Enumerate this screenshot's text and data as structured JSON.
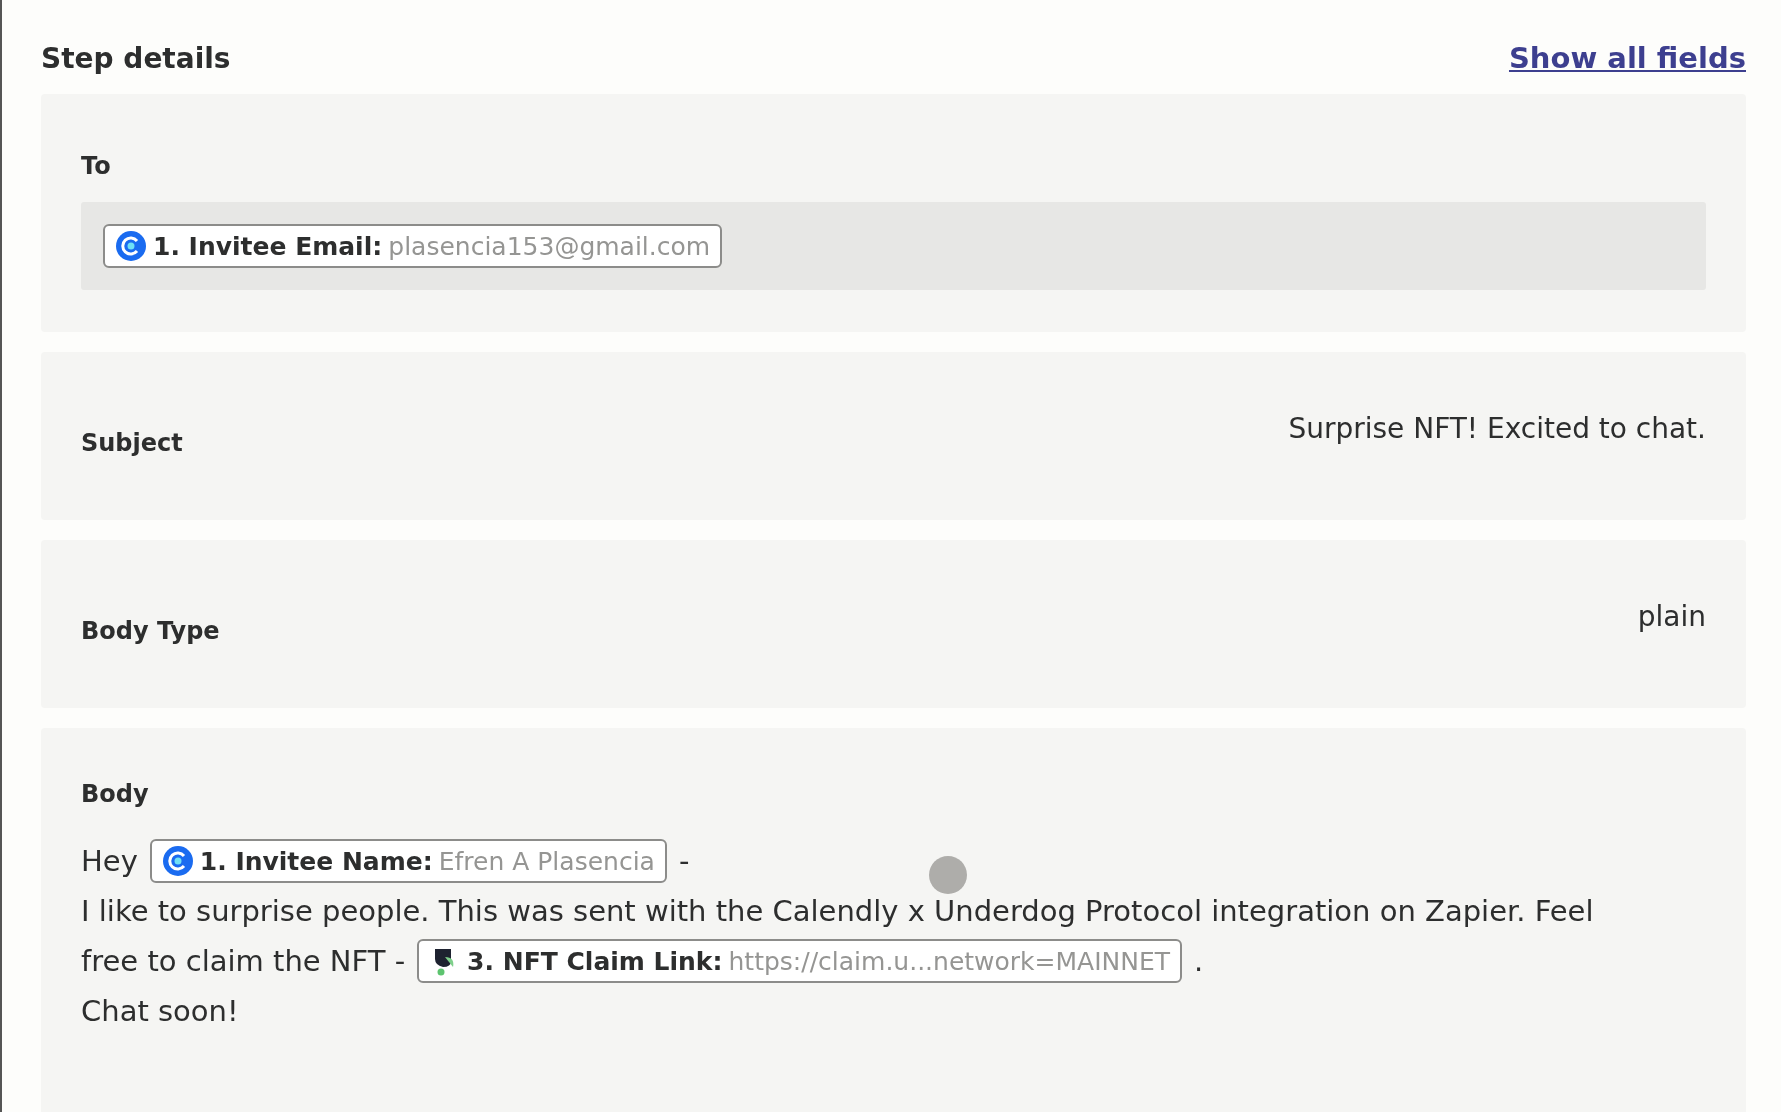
{
  "header": {
    "title": "Step details",
    "link": "Show all fields"
  },
  "fields": [
    {
      "kind": "pills",
      "label": "To",
      "pills": [
        {
          "kind": "calendly",
          "label": "1. Invitee Email:",
          "value": "plasencia153@gmail.com"
        }
      ]
    },
    {
      "kind": "value",
      "label": "Subject",
      "value": "Surprise NFT! Excited to chat."
    },
    {
      "kind": "value",
      "label": "Body Type",
      "value": "plain"
    },
    {
      "kind": "rich",
      "label": "Body",
      "lines": [
        [
          {
            "kind": "text",
            "text": "Hey"
          },
          {
            "kind": "calendly_pill",
            "label": "1. Invitee Name:",
            "value": "Efren A Plasencia"
          },
          {
            "kind": "text",
            "text": "-"
          }
        ],
        [
          {
            "kind": "text",
            "text": "I like to surprise people. This was sent with the Calendly x Underdog Protocol integration on Zapier. Feel"
          }
        ],
        [
          {
            "kind": "text",
            "text": "free to claim the NFT -"
          },
          {
            "kind": "underdog_pill",
            "label": "3. NFT Claim Link:",
            "value": "https://claim.u...network=MAINNET"
          },
          {
            "kind": "text",
            "text": "."
          }
        ],
        [
          {
            "kind": "text",
            "text": "Chat soon!"
          }
        ]
      ]
    }
  ]
}
